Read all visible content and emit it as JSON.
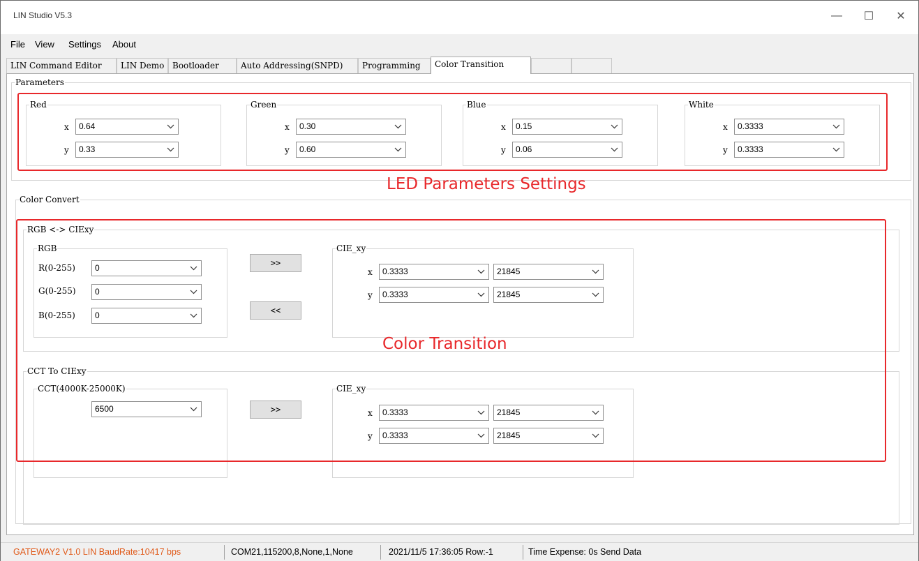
{
  "window": {
    "title": "LIN Studio V5.3",
    "minimize": "—",
    "maximize": "☐",
    "close": "✕"
  },
  "menu": [
    "File",
    "View",
    "Settings",
    "About"
  ],
  "tabs": [
    "LIN Command Editor",
    "LIN Demo",
    "Bootloader",
    "Auto Addressing(SNPD)",
    "Programming",
    "Color Transition"
  ],
  "active_tab": "Color Transition",
  "parameters": {
    "label": "Parameters",
    "groups": [
      {
        "name": "Red",
        "x": "0.64",
        "y": "0.33"
      },
      {
        "name": "Green",
        "x": "0.30",
        "y": "0.60"
      },
      {
        "name": "Blue",
        "x": "0.15",
        "y": "0.06"
      },
      {
        "name": "White",
        "x": "0.3333",
        "y": "0.3333"
      }
    ],
    "x_label": "x",
    "y_label": "y"
  },
  "color_convert": {
    "label": "Color Convert",
    "rgb_cie": {
      "label": "RGB <-> CIExy",
      "rgb_label": "RGB",
      "r_label": "R(0-255)",
      "r": "0",
      "g_label": "G(0-255)",
      "g": "0",
      "b_label": "B(0-255)",
      "b": "0",
      "to_cie_button": ">>",
      "to_rgb_button": "<<",
      "cie_label": "CIE_xy",
      "x": "0.3333",
      "x_raw": "21845",
      "y": "0.3333",
      "y_raw": "21845"
    },
    "cct_cie": {
      "label": "CCT To CIExy",
      "cct_label": "CCT(4000K-25000K)",
      "cct": "6500",
      "convert_button": ">>",
      "cie_label": "CIE_xy",
      "x": "0.3333",
      "x_raw": "21845",
      "y": "0.3333",
      "y_raw": "21845"
    }
  },
  "annotations": {
    "led": "LED Parameters Settings",
    "color": "Color Transition"
  },
  "status": {
    "gateway": "GATEWAY2  V1.0   LIN BaudRate:10417 bps",
    "com": "COM21,115200,8,None,1,None",
    "time": "2021/11/5 17:36:05  Row:-1",
    "info": "Time Expense: 0s  Send Data"
  },
  "colors": {
    "accent_red": "#e8282b",
    "status_orange": "#e05a1a"
  }
}
